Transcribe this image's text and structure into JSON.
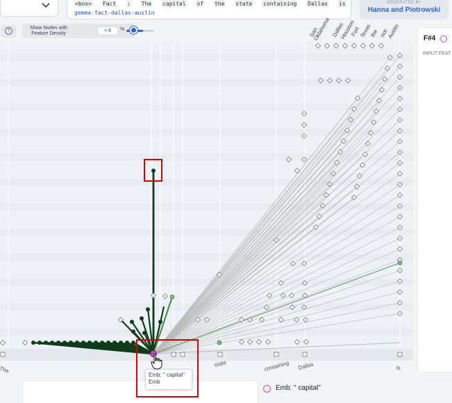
{
  "header": {
    "prompt_tokens": [
      "<bos>",
      "Fact",
      ":",
      "The",
      "capital",
      "of",
      "the",
      "state",
      "containing",
      "Dallas",
      "is"
    ],
    "prompt_id": "gemma-fact-dallas-austin",
    "generated_by_label": "GENERATED BY",
    "generated_by_author": "Hanna and Piotrowski"
  },
  "toolbar": {
    "help_label": "?",
    "density_label": "Show Nodes with Feature Density",
    "density_value": "< 6",
    "density_unit": "%",
    "density_percent": 6
  },
  "graph": {
    "x_labels": [
      "The",
      "state",
      "containing",
      "Dallas",
      "is"
    ],
    "top_labels": [
      "San",
      "Oklahoma",
      "Dallas",
      "Houston",
      "Fort",
      "Texas",
      "the",
      "not",
      "Austin"
    ]
  },
  "right_panel": {
    "title": "F#4",
    "input_label": "INPUT FEAT"
  },
  "tooltip": {
    "line1": "Emb: \" capital\"",
    "line2": "Emb"
  },
  "legend": {
    "text": "Emb: \" capital\""
  },
  "colors": {
    "accent": "#2563eb",
    "node_dark": "#0e3d1a",
    "node_pink": "#d63cc8",
    "highlight": "#e00000"
  }
}
